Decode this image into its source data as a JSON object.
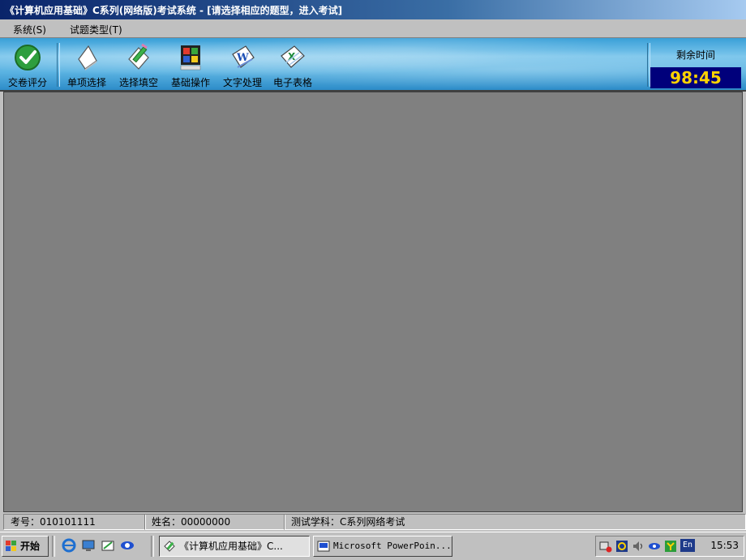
{
  "window": {
    "title": "《计算机应用基础》C系列(网络版)考试系统 - [请选择相应的题型，进入考试]"
  },
  "menu": [
    {
      "label": "系统(S)"
    },
    {
      "label": "试题类型(T)"
    }
  ],
  "toolbar": {
    "buttons": [
      {
        "label": "交卷评分",
        "icon": "check-circle-icon"
      },
      {
        "label": "单项选择",
        "icon": "paper-icon"
      },
      {
        "label": "选择填空",
        "icon": "pencil-paper-icon"
      },
      {
        "label": "基础操作",
        "icon": "windows-book-icon"
      },
      {
        "label": "文字处理",
        "icon": "word-doc-icon"
      },
      {
        "label": "电子表格",
        "icon": "excel-sheet-icon"
      }
    ],
    "timer": {
      "label": "剩余时间",
      "value": "98:45"
    }
  },
  "status": {
    "exam_no": "考号：010101111",
    "name": "姓名：00000000",
    "subject": "测试学科：C系列网络考试"
  },
  "taskbar": {
    "start_label": "开始",
    "tasks": [
      {
        "label": "《计算机应用基础》C...",
        "active": true
      },
      {
        "label": "Microsoft PowerPoin...",
        "active": false
      }
    ],
    "tray": {
      "lang": "En",
      "clock": "15:53"
    }
  },
  "colors": {
    "timer_bg": "#00007b",
    "timer_fg": "#ffd200",
    "workspace": "#808080",
    "title_bar": "#0a246a"
  }
}
